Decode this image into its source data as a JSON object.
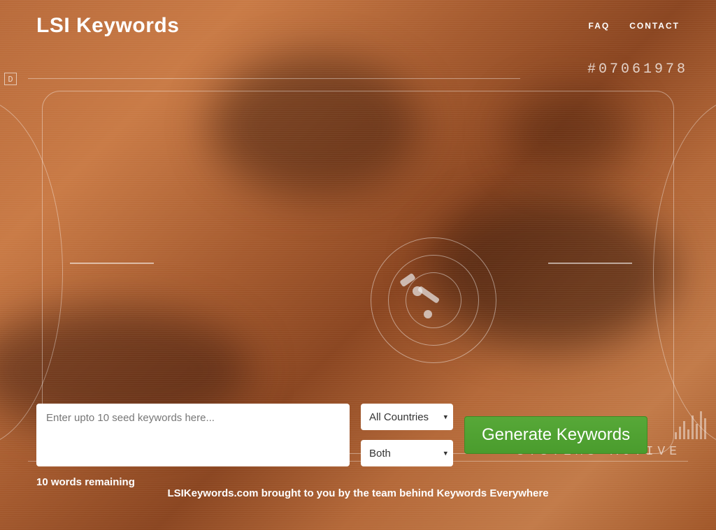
{
  "header": {
    "logo": "LSI Keywords",
    "nav": {
      "faq": "FAQ",
      "contact": "CONTACT"
    }
  },
  "hud": {
    "corner_code": "#07061978",
    "status": "SYSTEMS ACTIVE",
    "d_box": "D"
  },
  "form": {
    "seed_placeholder": "Enter upto 10 seed keywords here...",
    "country_selected": "All Countries",
    "type_selected": "Both",
    "generate_label": "Generate Keywords",
    "remaining": "10 words remaining"
  },
  "footer": {
    "credit": "LSIKeywords.com brought to you by the team behind Keywords Everywhere"
  }
}
